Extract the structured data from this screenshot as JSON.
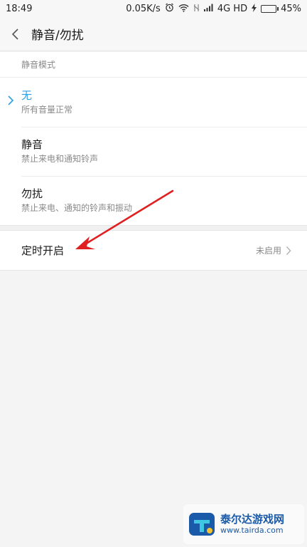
{
  "status_bar": {
    "time": "18:49",
    "speed": "0.05K/s",
    "network": "4G HD",
    "battery": "45%",
    "battery_level": 0.45,
    "battery_color": "#45c236"
  },
  "header": {
    "title": "静音/勿扰",
    "back_icon": "chevron-left-icon"
  },
  "silent_mode": {
    "section_label": "静音模式",
    "items": [
      {
        "title": "无",
        "subtitle": "所有音量正常",
        "selected": true
      },
      {
        "title": "静音",
        "subtitle": "禁止来电和通知铃声",
        "selected": false
      },
      {
        "title": "勿扰",
        "subtitle": "禁止来电、通知的铃声和振动",
        "selected": false
      }
    ]
  },
  "timer": {
    "title": "定时开启",
    "value": "未启用"
  },
  "colors": {
    "accent": "#2a9ee8",
    "annotation": "#e02020"
  },
  "watermark": {
    "name": "泰尔达游戏网",
    "url": "www.tairda.com"
  }
}
